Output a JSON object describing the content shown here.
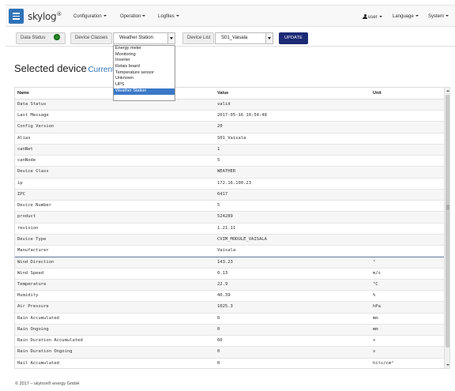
{
  "header": {
    "brand": "skylog",
    "brand_mark": "®",
    "menu": [
      "Configuration",
      "Operation",
      "Logfiles"
    ],
    "user": "user",
    "language": "Language",
    "system": "System"
  },
  "toolbar": {
    "data_status_label": "Data Status",
    "device_classes_label": "Device Classes",
    "device_class_value": "Weather Station",
    "device_list_label": "Device List",
    "device_list_value": "S01_Vaisala",
    "update_label": "UPDATE",
    "status_color": "#2a8a2a"
  },
  "device_class_options": [
    "Energy meter",
    "Monitoring",
    "Inverter",
    "Relais board",
    "Temperature sensor",
    "Unknown",
    "UPS",
    "Weather Station"
  ],
  "device_class_selected": "Weather Station",
  "heading": {
    "title": "Selected device",
    "subtitle": "Current"
  },
  "table": {
    "columns": [
      "Name",
      "Value",
      "Unit"
    ],
    "rows": [
      [
        "Data Status",
        "valid",
        ""
      ],
      [
        "Last Message",
        "2017-05-16 10:54:48",
        ""
      ],
      [
        "Config Version",
        "20",
        ""
      ],
      [
        "Alias",
        "S01_Vaisala",
        ""
      ],
      [
        "canNet",
        "1",
        ""
      ],
      [
        "canNode",
        "5",
        ""
      ],
      [
        "Device Class",
        "WEATHER",
        ""
      ],
      [
        "ip",
        "172.16.100.23",
        ""
      ],
      [
        "IPC",
        "6417",
        ""
      ],
      [
        "Device Number",
        "5",
        ""
      ],
      [
        "product",
        "524289",
        ""
      ],
      [
        "revision",
        "1.21.11",
        ""
      ],
      [
        "Device Type",
        "CVIM_MODULE_VAISALA",
        ""
      ],
      [
        "Manufacturer",
        "Vaisala",
        ""
      ],
      [
        "Wind Direction",
        "143.23",
        "°"
      ],
      [
        "Wind Speed",
        "0.13",
        "m/s"
      ],
      [
        "Temperature",
        "22.9",
        "°C"
      ],
      [
        "Humidity",
        "40.39",
        "%"
      ],
      [
        "Air Pressure",
        "1025.3",
        "hPa"
      ],
      [
        "Rain Accumulated",
        "0",
        "mm"
      ],
      [
        "Rain Ongoing",
        "0",
        "mm"
      ],
      [
        "Rain Duration Accumulated",
        "60",
        "s"
      ],
      [
        "Rain Duration Ongoing",
        "0",
        "s"
      ],
      [
        "Hail Accumulated",
        "0",
        "hits/cm²"
      ]
    ]
  },
  "footer": {
    "text": "© 2017 – skytron® energy GmbH"
  },
  "colors": {
    "accent": "#2f72b7",
    "update_button": "#1d2a74",
    "selected_option": "#3b78c8"
  }
}
